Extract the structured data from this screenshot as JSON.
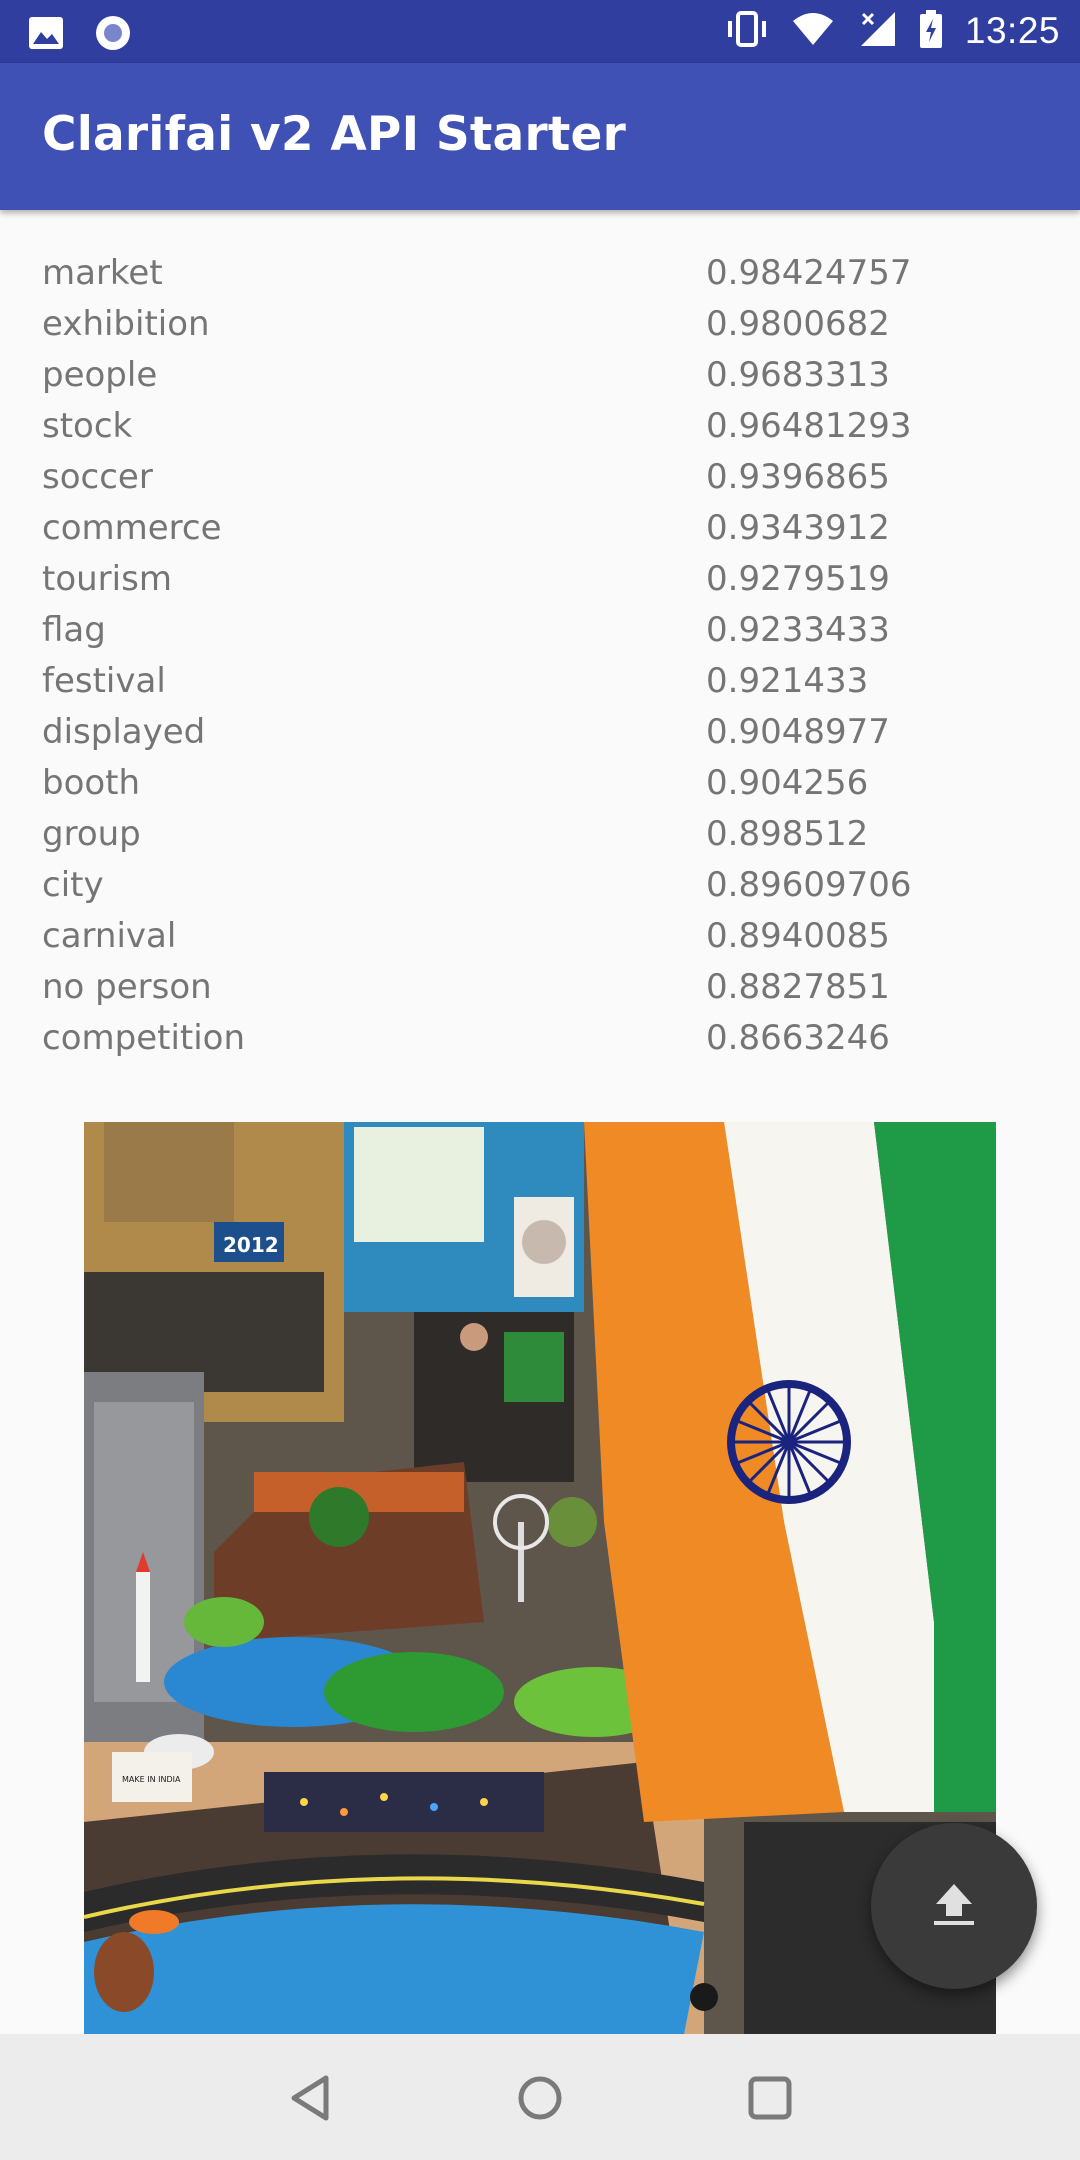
{
  "status_bar": {
    "time": "13:25",
    "left_icons": [
      "image-icon",
      "record-icon"
    ],
    "right_icons": [
      "vibrate-icon",
      "wifi-icon",
      "signal-icon",
      "battery-icon"
    ]
  },
  "app_bar": {
    "title": "Clarifai v2 API Starter"
  },
  "results": [
    {
      "concept": "market",
      "score": "0.98424757"
    },
    {
      "concept": "exhibition",
      "score": "0.9800682"
    },
    {
      "concept": "people",
      "score": "0.9683313"
    },
    {
      "concept": "stock",
      "score": "0.96481293"
    },
    {
      "concept": "soccer",
      "score": "0.9396865"
    },
    {
      "concept": "commerce",
      "score": "0.9343912"
    },
    {
      "concept": "tourism",
      "score": "0.9279519"
    },
    {
      "concept": "flag",
      "score": "0.9233433"
    },
    {
      "concept": "festival",
      "score": "0.921433"
    },
    {
      "concept": "displayed",
      "score": "0.9048977"
    },
    {
      "concept": "booth",
      "score": "0.904256"
    },
    {
      "concept": "group",
      "score": "0.898512"
    },
    {
      "concept": "city",
      "score": "0.89609706"
    },
    {
      "concept": "carnival",
      "score": "0.8940085"
    },
    {
      "concept": "no person",
      "score": "0.8827851"
    },
    {
      "concept": "competition",
      "score": "0.8663246"
    }
  ],
  "photo": {
    "poster_text": "2012",
    "sign_text": "MAKE IN INDIA"
  },
  "fab": {
    "icon": "upload-icon"
  },
  "nav_bar": {
    "icons": [
      "back-icon",
      "home-icon",
      "recents-icon"
    ]
  },
  "colors": {
    "status_bar": "#303f9f",
    "app_bar": "#3f51b5",
    "background": "#fafafa",
    "text_secondary": "#757575",
    "fab": "#3a3a3a",
    "flag_saffron": "#f08a24",
    "flag_white": "#f7f5ef",
    "flag_green": "#1f9a47",
    "chakra_navy": "#1a237e"
  }
}
